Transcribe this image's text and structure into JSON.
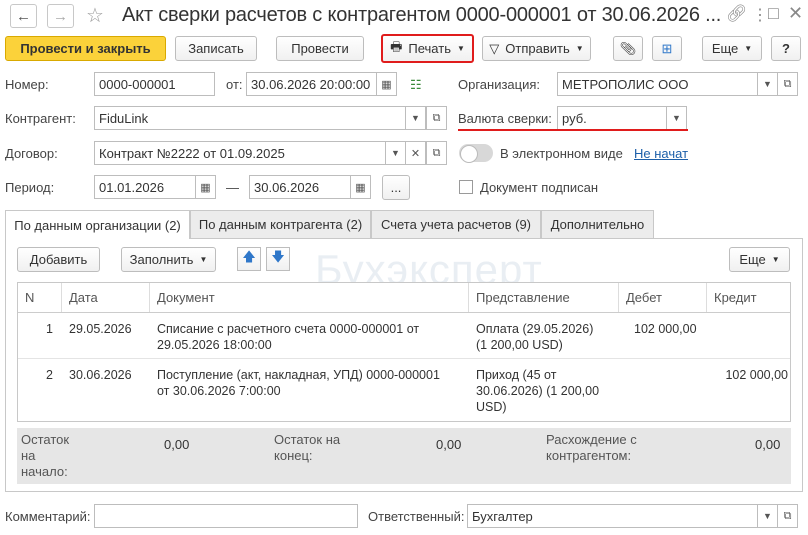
{
  "title": "Акт сверки расчетов с контрагентом 0000-000001 от 30.06.2026 ...",
  "toolbar": {
    "post_close": "Провести и закрыть",
    "save": "Записать",
    "post": "Провести",
    "print": "Печать",
    "send": "Отправить",
    "more": "Еще",
    "help": "?"
  },
  "form": {
    "number_label": "Номер:",
    "number_value": "0000-000001",
    "from_label": "от:",
    "date_value": "30.06.2026 20:00:00",
    "org_label": "Организация:",
    "org_value": "МЕТРОПОЛИС ООО",
    "counterparty_label": "Контрагент:",
    "counterparty_value": "FiduLink",
    "currency_label": "Валюта сверки:",
    "currency_value": "руб.",
    "contract_label": "Договор:",
    "contract_value": "Контракт №2222 от 01.09.2025",
    "electronic_label": "В электронном виде",
    "electronic_link": "Не начат",
    "period_label": "Период:",
    "period_from": "01.01.2026",
    "period_dash": "—",
    "period_to": "30.06.2026",
    "period_more": "...",
    "signed_label": "Документ подписан"
  },
  "tabs": [
    {
      "label": "По данным организации (2)",
      "active": true
    },
    {
      "label": "По данным контрагента (2)",
      "active": false
    },
    {
      "label": "Счета учета расчетов (9)",
      "active": false
    },
    {
      "label": "Дополнительно",
      "active": false
    }
  ],
  "table_toolbar": {
    "add": "Добавить",
    "fill": "Заполнить",
    "more": "Еще"
  },
  "watermark": "Бухэксперт",
  "table": {
    "columns": [
      "N",
      "Дата",
      "Документ",
      "Представление",
      "Дебет",
      "Кредит"
    ],
    "rows": [
      {
        "n": "1",
        "date": "29.05.2026",
        "doc1": "Списание с расчетного счета 0000-000001 от",
        "doc2": "29.05.2026 18:00:00",
        "doc3": "",
        "rep1": "Оплата (29.05.2026)",
        "rep2": "(1 200,00 USD)",
        "rep3": "",
        "debit": "102 000,00",
        "credit": ""
      },
      {
        "n": "2",
        "date": "30.06.2026",
        "doc1": "Поступление (акт, накладная, УПД) 0000-000001",
        "doc2": "от 30.06.2026 7:00:00",
        "doc3": "",
        "rep1": "Приход (45 от",
        "rep2": "30.06.2026) (1 200,00",
        "rep3": "USD)",
        "debit": "",
        "credit": "102 000,00"
      }
    ]
  },
  "totals": {
    "start_label_1": "Остаток",
    "start_label_2": "на",
    "start_label_3": "начало:",
    "start_value": "0,00",
    "end_label_1": "Остаток на",
    "end_label_2": "конец:",
    "end_value": "0,00",
    "diff_label_1": "Расхождение с",
    "diff_label_2": "контрагентом:",
    "diff_value": "0,00"
  },
  "bottom": {
    "comment_label": "Комментарий:",
    "comment_value": "",
    "responsible_label": "Ответственный:",
    "responsible_value": "Бухгалтер"
  }
}
